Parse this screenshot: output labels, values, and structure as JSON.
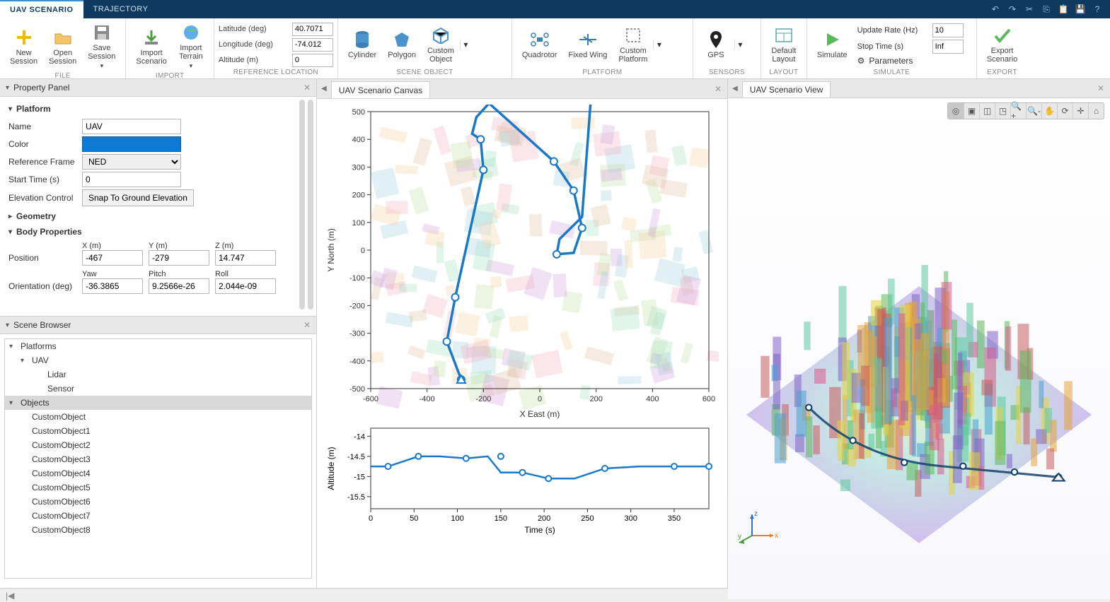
{
  "tabs": {
    "scenario": "UAV SCENARIO",
    "trajectory": "TRAJECTORY"
  },
  "ribbon": {
    "file": {
      "label": "FILE",
      "new": "New\nSession",
      "open": "Open\nSession",
      "save": "Save\nSession"
    },
    "import": {
      "label": "IMPORT",
      "scenario": "Import\nScenario",
      "terrain": "Import\nTerrain"
    },
    "refloc": {
      "label": "REFERENCE LOCATION",
      "lat_lbl": "Latitude (deg)",
      "lat": "40.7071",
      "lon_lbl": "Longitude (deg)",
      "lon": "-74.012",
      "alt_lbl": "Altitude (m)",
      "alt": "0"
    },
    "sceneobj": {
      "label": "SCENE OBJECT",
      "cylinder": "Cylinder",
      "polygon": "Polygon",
      "custom": "Custom\nObject"
    },
    "platform": {
      "label": "PLATFORM",
      "quad": "Quadrotor",
      "fixed": "Fixed Wing",
      "custom": "Custom\nPlatform"
    },
    "sensors": {
      "label": "SENSORS",
      "gps": "GPS"
    },
    "layout": {
      "label": "LAYOUT",
      "default": "Default\nLayout"
    },
    "simulate": {
      "label": "SIMULATE",
      "sim": "Simulate",
      "rate_lbl": "Update Rate (Hz)",
      "rate": "10",
      "stop_lbl": "Stop Time (s)",
      "stop": "Inf",
      "params": "Parameters"
    },
    "export": {
      "label": "EXPORT",
      "btn": "Export\nScenario"
    }
  },
  "property": {
    "title": "Property Panel",
    "platform_hdr": "Platform",
    "name_lbl": "Name",
    "name": "UAV",
    "color_lbl": "Color",
    "refframe_lbl": "Reference Frame",
    "refframe": "NED",
    "start_lbl": "Start Time (s)",
    "start": "0",
    "elev_lbl": "Elevation Control",
    "snap": "Snap To Ground Elevation",
    "geometry_hdr": "Geometry",
    "body_hdr": "Body Properties",
    "position_lbl": "Position",
    "x_lbl": "X (m)",
    "y_lbl": "Y (m)",
    "z_lbl": "Z (m)",
    "x": "-467",
    "y": "-279",
    "z": "14.747",
    "orient_lbl": "Orientation (deg)",
    "yaw_lbl": "Yaw",
    "pitch_lbl": "Pitch",
    "roll_lbl": "Roll",
    "yaw": "-36.3865",
    "pitch": "9.2566e-26",
    "roll": "2.044e-09"
  },
  "scene": {
    "title": "Scene Browser",
    "platforms": "Platforms",
    "uav": "UAV",
    "lidar": "Lidar",
    "sensor": "Sensor",
    "objects": "Objects",
    "items": [
      "CustomObject",
      "CustomObject1",
      "CustomObject2",
      "CustomObject3",
      "CustomObject4",
      "CustomObject5",
      "CustomObject6",
      "CustomObject7",
      "CustomObject8"
    ]
  },
  "canvas": {
    "tab": "UAV Scenario Canvas",
    "xlab": "X East (m)",
    "ylab": "Y North (m)",
    "altlab": "Altitude (m)",
    "timelab": "Time (s)"
  },
  "view": {
    "tab": "UAV Scenario View"
  },
  "chart_data": [
    {
      "type": "line",
      "title": "UAV Scenario Canvas",
      "xlabel": "X East (m)",
      "ylabel": "Y North (m)",
      "xlim": [
        -600,
        600
      ],
      "ylim": [
        -500,
        500
      ],
      "xticks": [
        -600,
        -400,
        -200,
        0,
        200,
        400,
        600
      ],
      "yticks": [
        -500,
        -400,
        -300,
        -200,
        -100,
        0,
        100,
        200,
        300,
        400,
        500
      ],
      "series": [
        {
          "name": "trajectory",
          "x": [
            -279,
            -330,
            -300,
            -200,
            -210,
            -240,
            -225,
            -180,
            50,
            120,
            150,
            120,
            60,
            70,
            150,
            180
          ],
          "y": [
            -467,
            -330,
            -170,
            290,
            400,
            420,
            480,
            530,
            320,
            215,
            80,
            -10,
            -15,
            40,
            120,
            530
          ],
          "waypoints_x": [
            -279,
            -330,
            -300,
            -200,
            -210,
            50,
            120,
            150,
            60
          ],
          "waypoints_y": [
            -467,
            -330,
            -170,
            290,
            400,
            320,
            215,
            80,
            -15
          ]
        }
      ]
    },
    {
      "type": "line",
      "xlabel": "Time (s)",
      "ylabel": "Altitude (m)",
      "xlim": [
        0,
        390
      ],
      "ylim": [
        -15.8,
        -13.8
      ],
      "xticks": [
        0,
        50,
        100,
        150,
        200,
        250,
        300,
        350
      ],
      "yticks": [
        -15.5,
        -15,
        -14.5,
        -14
      ],
      "series": [
        {
          "name": "altitude",
          "x": [
            0,
            20,
            55,
            80,
            110,
            135,
            150,
            175,
            205,
            235,
            270,
            310,
            350,
            390
          ],
          "y": [
            -14.75,
            -14.75,
            -14.5,
            -14.5,
            -14.55,
            -14.5,
            -14.9,
            -14.9,
            -15.05,
            -15.05,
            -14.8,
            -14.75,
            -14.75,
            -14.75
          ],
          "waypoints_x": [
            20,
            55,
            110,
            150,
            175,
            205,
            270,
            350,
            390
          ],
          "waypoints_y": [
            -14.75,
            -14.5,
            -14.55,
            -14.5,
            -14.9,
            -15.05,
            -14.8,
            -14.75,
            -14.75
          ]
        }
      ]
    }
  ]
}
